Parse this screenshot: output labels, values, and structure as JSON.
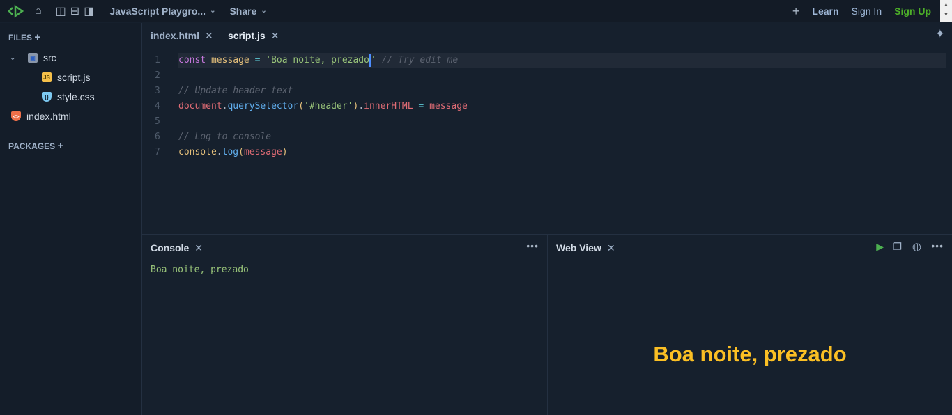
{
  "topbar": {
    "title": "JavaScript Playgro...",
    "share": "Share",
    "learn": "Learn",
    "sign_in": "Sign In",
    "sign_up": "Sign Up",
    "colors": {
      "logo": "#4caf50",
      "sign_up": "#4caf28"
    }
  },
  "sidebar": {
    "files_label": "FILES",
    "packages_label": "PACKAGES",
    "tree": [
      {
        "name": "src",
        "type": "folder"
      },
      {
        "name": "script.js",
        "type": "js"
      },
      {
        "name": "style.css",
        "type": "css"
      },
      {
        "name": "index.html",
        "type": "html"
      }
    ]
  },
  "tabs": [
    {
      "label": "index.html",
      "active": false
    },
    {
      "label": "script.js",
      "active": true
    }
  ],
  "code": [
    [
      {
        "t": "const ",
        "c": "#c678dd"
      },
      {
        "t": "message ",
        "c": "#e5c07b"
      },
      {
        "t": "= ",
        "c": "#56b6c2"
      },
      {
        "t": "'Boa noite, prezado",
        "c": "#98c379"
      },
      {
        "t": "|CARET|",
        "c": ""
      },
      {
        "t": "' ",
        "c": "#98c379"
      },
      {
        "t": "// Try edit me",
        "c": "#5c6370",
        "i": true
      }
    ],
    [],
    [
      {
        "t": "// Update header text",
        "c": "#5c6370",
        "i": true
      }
    ],
    [
      {
        "t": "document",
        "c": "#e06c75"
      },
      {
        "t": ".",
        "c": "#abb2bf"
      },
      {
        "t": "querySelector",
        "c": "#61afef"
      },
      {
        "t": "(",
        "c": "#e5c07b"
      },
      {
        "t": "'#header'",
        "c": "#98c379"
      },
      {
        "t": ")",
        "c": "#e5c07b"
      },
      {
        "t": ".",
        "c": "#abb2bf"
      },
      {
        "t": "innerHTML ",
        "c": "#e06c75"
      },
      {
        "t": "= ",
        "c": "#56b6c2"
      },
      {
        "t": "message",
        "c": "#e06c75"
      }
    ],
    [],
    [
      {
        "t": "// Log to console",
        "c": "#5c6370",
        "i": true
      }
    ],
    [
      {
        "t": "console",
        "c": "#e5c07b"
      },
      {
        "t": ".",
        "c": "#abb2bf"
      },
      {
        "t": "log",
        "c": "#61afef"
      },
      {
        "t": "(",
        "c": "#e5c07b"
      },
      {
        "t": "message",
        "c": "#e06c75"
      },
      {
        "t": ")",
        "c": "#e5c07b"
      }
    ]
  ],
  "console": {
    "title": "Console",
    "output": "Boa noite, prezado"
  },
  "webview": {
    "title": "Web View",
    "header": "Boa noite, prezado",
    "header_color": "#fbbf24"
  }
}
